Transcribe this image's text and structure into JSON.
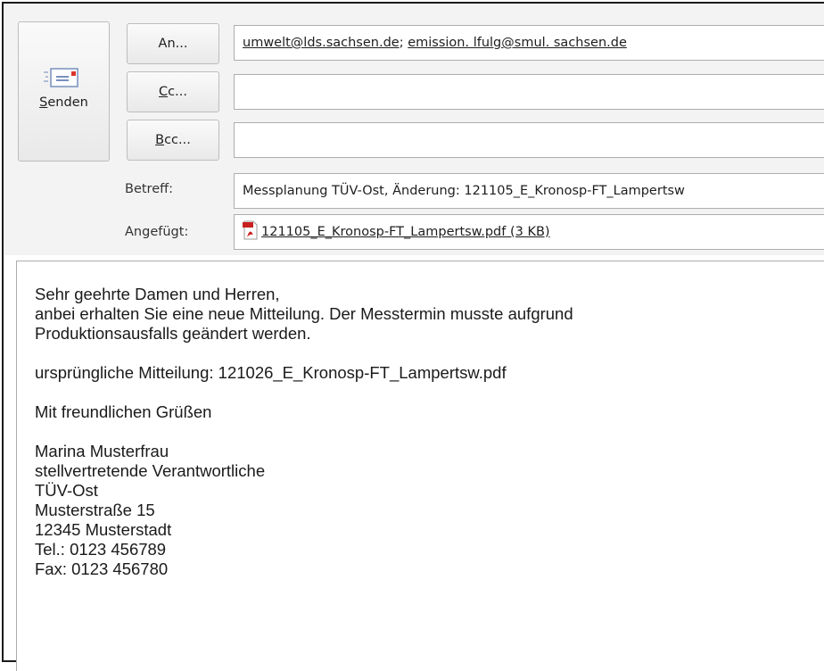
{
  "header": {
    "send_label": "Senden",
    "to_label": "An...",
    "cc_label": "Cc...",
    "bcc_label": "Bcc...",
    "subject_label": "Betreff:",
    "attached_label": "Angefügt:"
  },
  "recipients": {
    "to": [
      "umwelt@lds.sachsen.de",
      "emission. lfulg@smul. sachsen.de"
    ],
    "separator": "; ",
    "cc": "",
    "bcc": ""
  },
  "subject": "Messplanung TÜV-Ost, Änderung: 121105_E_Kronosp-FT_Lampertsw",
  "attachment": {
    "name": "121105_E_Kronosp-FT_Lampertsw.pdf (3 KB)",
    "icon": "pdf-file-icon"
  },
  "body": {
    "greeting": "Sehr geehrte Damen und Herren,",
    "line2": "anbei erhalten Sie eine neue Mitteilung. Der Messtermin musste aufgrund",
    "line3": "Produktionsausfalls geändert werden.",
    "original": "ursprüngliche Mitteilung:  121026_E_Kronosp-FT_Lampertsw.pdf",
    "closing": "Mit freundlichen Grüßen",
    "signature": [
      "Marina Musterfrau",
      "stellvertretende Verantwortliche",
      "TÜV-Ost",
      "Musterstraße 15",
      "12345 Musterstadt",
      "Tel.:  0123 456789",
      "Fax:  0123 456780"
    ]
  },
  "colors": {
    "header_bg": "#f3f3f3",
    "pdf_red": "#c8201f",
    "border": "#adadad"
  }
}
